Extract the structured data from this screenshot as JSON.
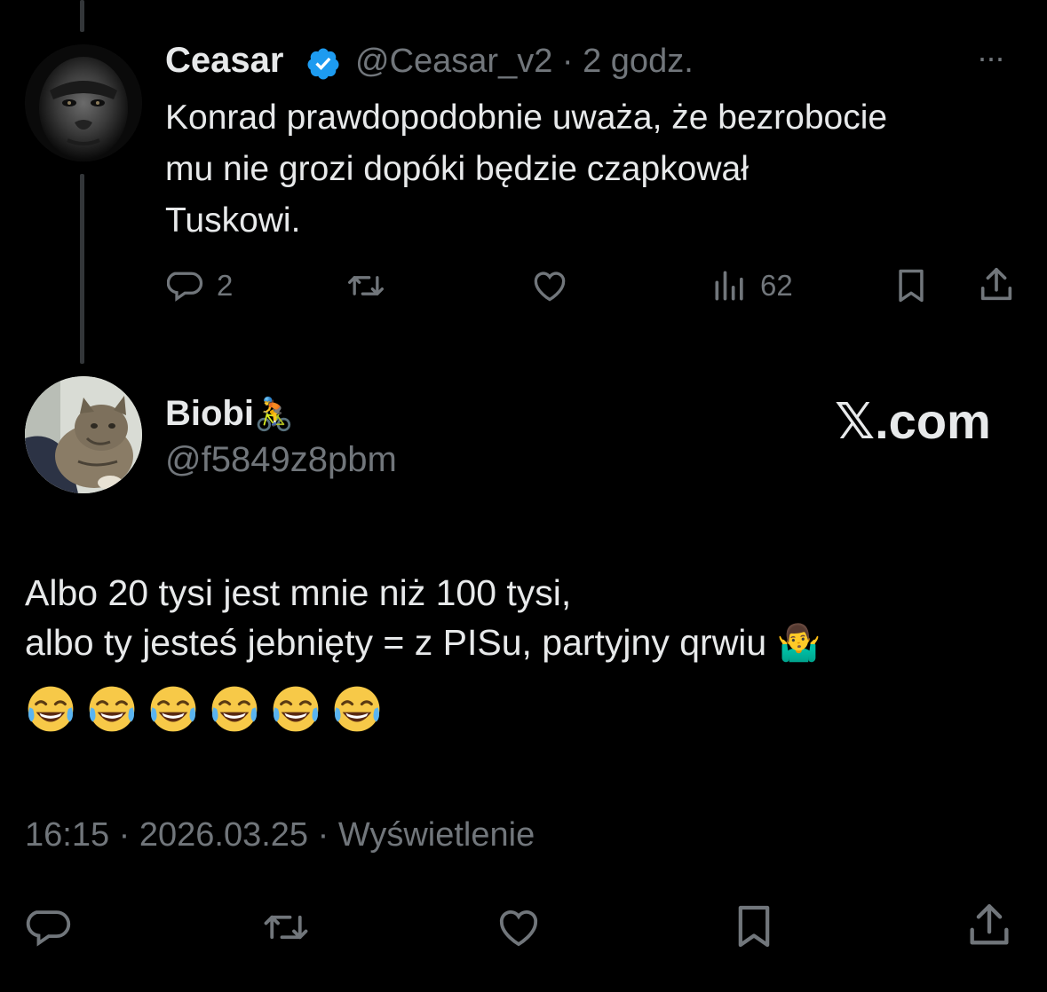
{
  "parent_tweet": {
    "author_name": "Ceasar",
    "handle_time": "@Ceasar_v2 · 2 godz.",
    "more": "···",
    "text_lines": [
      "Konrad prawdopodobnie uważa, że bezrobocie",
      "mu nie grozi dopóki będzie czapkował",
      "Tuskowi."
    ],
    "replies_count": "2",
    "views_count": "62",
    "icons": [
      "reply-icon",
      "retweet-icon",
      "like-icon",
      "views-icon",
      "bookmark-icon",
      "share-icon"
    ]
  },
  "main_tweet": {
    "author_name": "Biobi",
    "author_emoji": "🚴",
    "handle": "@f5849z8pbm",
    "watermark": "𝕏.com",
    "text_lines": [
      "Albo 20 tysi jest mnie niż 100 tysi,",
      "albo ty jesteś jebnięty = z PISu, partyjny qrwiu"
    ],
    "trailing_emoji": "🤷‍♂️",
    "laugh_emoji": [
      "😂",
      "😂",
      "😂",
      "😂",
      "😂",
      "😂"
    ],
    "meta": "16:15 · 2026.03.25 · Wyświetlenie",
    "icons": [
      "reply-icon",
      "retweet-icon",
      "like-icon",
      "bookmark-icon",
      "share-icon"
    ]
  },
  "colors": {
    "background": "#000000",
    "text": "#e7e9ea",
    "muted": "#71767b",
    "verified": "#1d9bf0",
    "thread_line": "#333639"
  }
}
